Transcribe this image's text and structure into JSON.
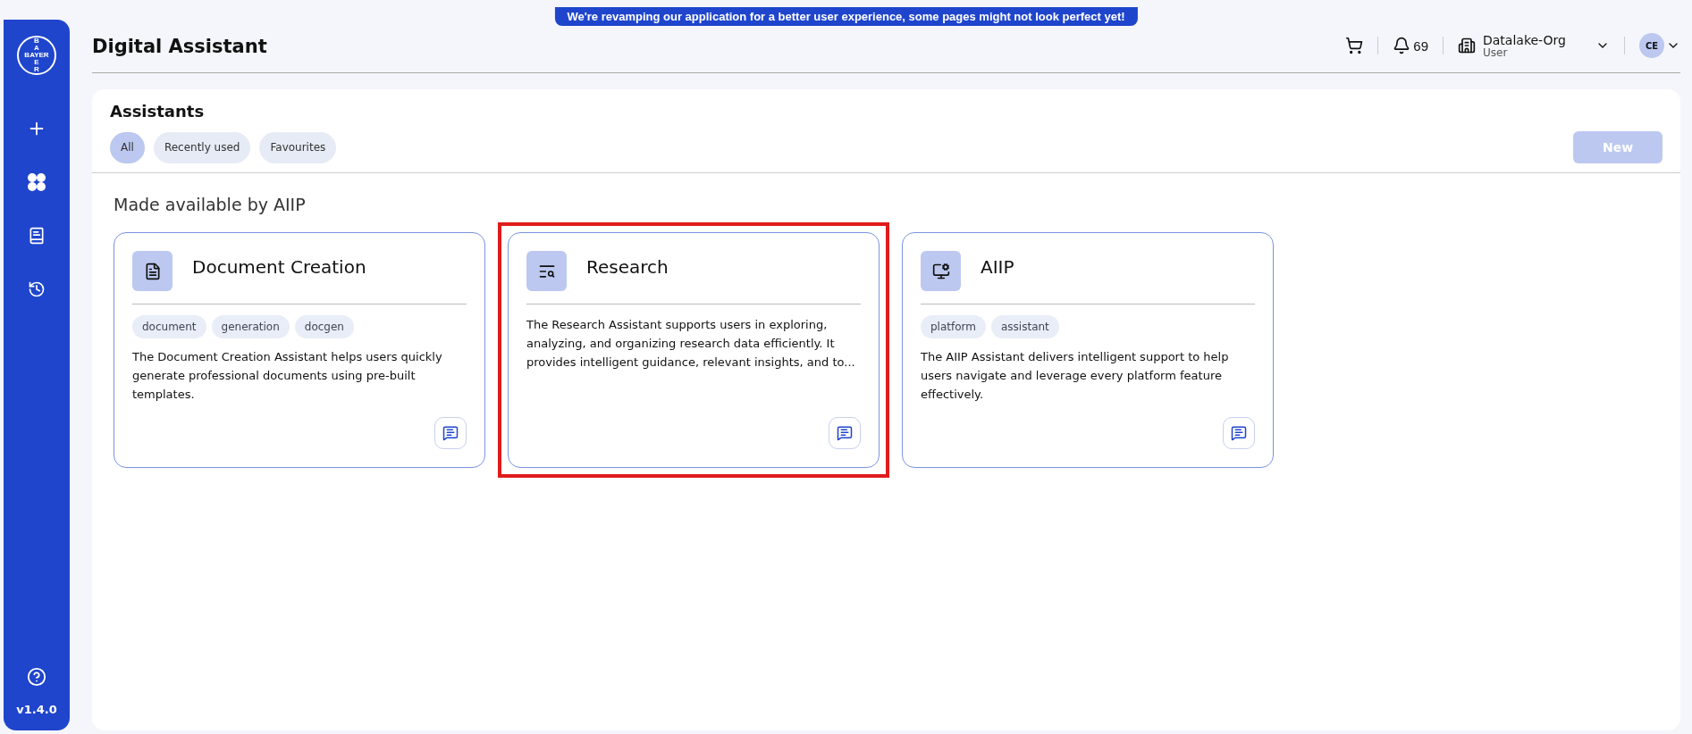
{
  "banner": "We're revamping our application for a better user experience, some pages might not look perfect yet!",
  "sidebar": {
    "logo": {
      "horizontal": "BAYER",
      "vertical_top": "BA",
      "vertical_bottom": "ER"
    },
    "items": [
      {
        "kind": "new"
      },
      {
        "kind": "assistants"
      },
      {
        "kind": "library"
      },
      {
        "kind": "history"
      }
    ],
    "version": "v1.4.0"
  },
  "header": {
    "title": "Digital Assistant",
    "notifications": "69",
    "org": {
      "name": "Datalake-Org",
      "role": "User"
    },
    "avatar": "CE"
  },
  "panel": {
    "title": "Assistants",
    "filters": [
      {
        "label": "All",
        "selected": true
      },
      {
        "label": "Recently used",
        "selected": false
      },
      {
        "label": "Favourites",
        "selected": false
      }
    ],
    "new_button": {
      "label": "New",
      "disabled": true
    },
    "section_title": "Made available by AIIP",
    "cards": [
      {
        "kind": "document",
        "title": "Document Creation",
        "tags": [
          "document",
          "generation",
          "docgen"
        ],
        "description": "The Document Creation Assistant helps users quickly generate professional documents using pre-built templates.",
        "highlighted": false
      },
      {
        "kind": "research",
        "title": "Research",
        "description": "The Research Assistant supports users in exploring, analyzing, and organizing research data efficiently. It provides intelligent guidance, relevant insights, and to...",
        "highlighted": true
      },
      {
        "kind": "platform",
        "title": "AIIP",
        "tags": [
          "platform",
          "assistant"
        ],
        "description": "The AIIP Assistant delivers intelligent support to help users navigate and leverage every platform feature effectively.",
        "highlighted": false
      }
    ]
  }
}
